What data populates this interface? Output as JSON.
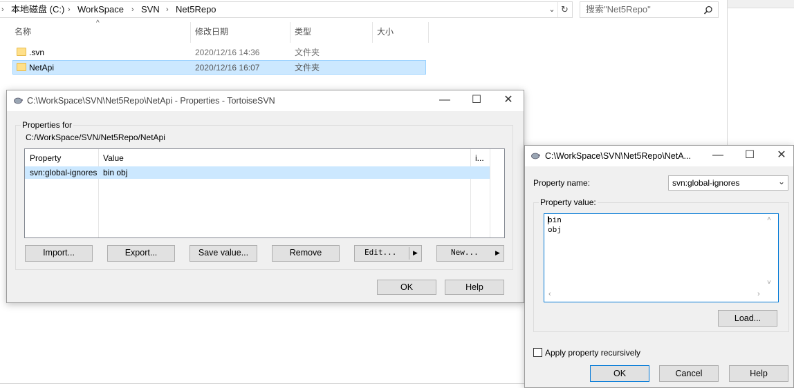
{
  "explorer": {
    "breadcrumb": [
      "本地磁盘 (C:)",
      "WorkSpace",
      "SVN",
      "Net5Repo"
    ],
    "search_placeholder": "搜索\"Net5Repo\"",
    "columns": {
      "name": "名称",
      "date": "修改日期",
      "type": "类型",
      "size": "大小"
    },
    "rows": [
      {
        "name": ".svn",
        "date": "2020/12/16 14:36",
        "type": "文件夹"
      },
      {
        "name": "NetApi",
        "date": "2020/12/16 16:07",
        "type": "文件夹"
      }
    ]
  },
  "props_dialog": {
    "title": "C:\\WorkSpace\\SVN\\Net5Repo\\NetApi - Properties - TortoiseSVN",
    "group_label": "Properties for",
    "path": "C:/WorkSpace/SVN/Net5Repo/NetApi",
    "columns": {
      "property": "Property",
      "value": "Value",
      "extra": "i..."
    },
    "rows": [
      {
        "property": "svn:global-ignores",
        "value": "bin obj"
      }
    ],
    "buttons": {
      "import": "Import...",
      "export": "Export...",
      "save_value": "Save value...",
      "remove": "Remove",
      "edit": "Edit...",
      "new": "New...",
      "ok": "OK",
      "help": "Help"
    }
  },
  "edit_dialog": {
    "title": "C:\\WorkSpace\\SVN\\Net5Repo\\NetA...",
    "name_label": "Property name:",
    "name_value": "svn:global-ignores",
    "value_label": "Property value:",
    "value_lines": [
      "bin",
      "obj"
    ],
    "load_button": "Load...",
    "recursive_label": "Apply property recursively",
    "recursive_checked": false,
    "buttons": {
      "ok": "OK",
      "cancel": "Cancel",
      "help": "Help"
    }
  }
}
